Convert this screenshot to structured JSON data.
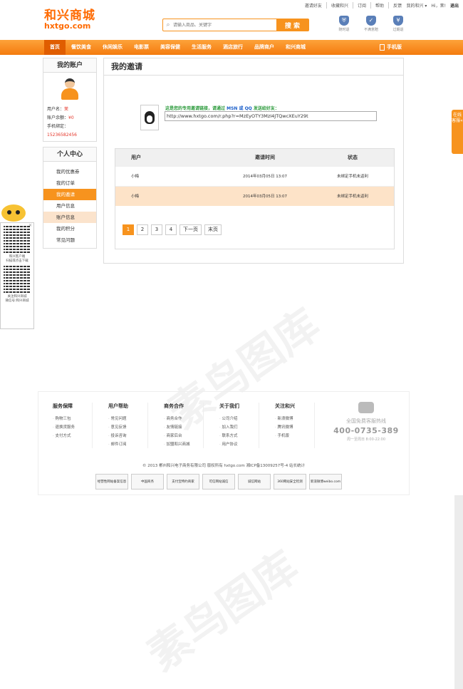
{
  "top_links": [
    "邀请好友",
    "收藏和兴",
    "订阅",
    "帮助",
    "反馈"
  ],
  "user_bar": {
    "my_hexing": "我的和兴 ▾",
    "greeting": "Hi，茉!",
    "logout": "退出"
  },
  "logo": {
    "cn": "和兴商城",
    "en": "hxtgo.com"
  },
  "search": {
    "placeholder": "请输入商品、关键字",
    "button": "搜 索",
    "icon": "search-icon"
  },
  "badges": [
    {
      "label": "随时退",
      "icon": "shield-icon"
    },
    {
      "label": "不满意赔",
      "icon": "shield-check-icon"
    },
    {
      "label": "过期退",
      "icon": "shield-yen-icon"
    }
  ],
  "nav": {
    "items": [
      "首页",
      "餐饮美食",
      "休闲娱乐",
      "电影票",
      "美容保健",
      "生活服务",
      "酒店旅行",
      "品牌商户",
      "和兴商城"
    ],
    "active_index": 0,
    "mobile": "手机版"
  },
  "account_panel": {
    "title": "我的账户",
    "username_label": "用户名：",
    "username": "茉",
    "balance_label": "账户余额：",
    "balance": "¥0",
    "phone_label": "手机绑定：",
    "phone": "15236582456"
  },
  "center_panel": {
    "title": "个人中心",
    "items": [
      "我的优惠券",
      "我的订单",
      "我的邀请",
      "用户信息",
      "账户信息",
      "我的积分",
      "常见问题"
    ],
    "active_index": 2
  },
  "main": {
    "title": "我的邀请",
    "hint_prefix": "这是您的专用邀请链接，请通过 ",
    "hint_channels": "MSN 或 QQ",
    "hint_suffix": " 发送给好友：",
    "invite_link": "http://www.hxtgo.com/r.php?r=MzEyOTY3MzI4JTQwcXEuY29t",
    "table": {
      "headers": [
        "用户",
        "邀请时间",
        "状态"
      ],
      "rows": [
        {
          "user": "小梅",
          "time": "2014年03月05日  13:07",
          "status": "未绑定手机未返利"
        },
        {
          "user": "小梅",
          "time": "2014年03月05日  13:07",
          "status": "未绑定手机未返利"
        }
      ]
    },
    "pager": {
      "pages": [
        "1",
        "2",
        "3",
        "4"
      ],
      "current": "1",
      "next": "下一页",
      "last": "末页"
    }
  },
  "qr_panel": {
    "close": "✕",
    "caption1_a": "和兴客户端",
    "caption1_b": "扫描或点击下载",
    "caption2_a": "关注和兴商城",
    "caption2_b": "微信号:和兴商城"
  },
  "online_service": "在线客服«",
  "footer": {
    "columns": [
      {
        "title": "服务保障",
        "links": [
          "购物三包",
          "退换货服务",
          "支付方式"
        ]
      },
      {
        "title": "用户帮助",
        "links": [
          "常见问题",
          "意见反馈",
          "投诉咨询",
          "邮件订阅"
        ]
      },
      {
        "title": "商务合作",
        "links": [
          "商务合作",
          "友情链接",
          "商家后台",
          "加盟和兴商城"
        ]
      },
      {
        "title": "关于我们",
        "links": [
          "公司介绍",
          "加入我们",
          "联系方式",
          "用户协议"
        ]
      },
      {
        "title": "关注和兴",
        "links": [
          "新浪微博",
          "腾讯微博",
          "手机版"
        ]
      }
    ],
    "hotline": {
      "label": "全国免费客服热线",
      "number": "400-0735-389",
      "hours": "周一至周日 8:00-22:00"
    },
    "copyright": "© 2013 郴州和兴电子商务有限公司 版权所有 hxtgo.com 湘ICP备13009257号-4 站长统计",
    "certs": [
      "经营性网站备案信息",
      "中国商务",
      "支付宝特约商家",
      "可信网站诚信",
      "诚信网站",
      "360网站安全检测",
      "新浪微博weibo.com"
    ]
  },
  "watermark": "素鸟图库"
}
